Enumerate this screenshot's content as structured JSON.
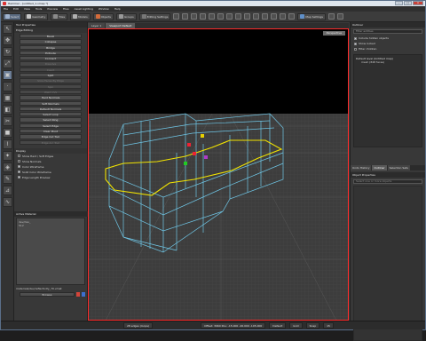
{
  "window": {
    "title": "Hammer - [untitled_1.vmap *]"
  },
  "menu": [
    "File",
    "Edit",
    "View",
    "Tools",
    "Preview",
    "Files",
    "Asset Lighting",
    "Window",
    "Help"
  ],
  "toolbar": {
    "groups": [
      "Select",
      "Geometry",
      "Tiles",
      "Models",
      "Objects",
      "Groups",
      "Editing Settings"
    ],
    "map_settings_label": "Map Settings",
    "right_tabs": [
      "Main",
      "Blend",
      "Mesh"
    ]
  },
  "viewport_tabs": [
    "Layer 1",
    "Viewport Default"
  ],
  "left_panel": {
    "title": "Tool Properties",
    "section": "Edge Editing",
    "buttons": [
      {
        "label": "Bevel",
        "enabled": true
      },
      {
        "label": "Collapse",
        "enabled": true
      },
      {
        "label": "Bridge",
        "enabled": true
      },
      {
        "label": "Extrude",
        "enabled": true
      },
      {
        "label": "Connect",
        "enabled": true
      },
      {
        "label": "Dissolve",
        "enabled": false
      },
      {
        "label": "Insert",
        "enabled": false
      },
      {
        "label": "Split",
        "enabled": true
      },
      {
        "label": "Slice Faces By Edge",
        "enabled": false
      },
      {
        "label": "Spin",
        "enabled": false
      },
      {
        "label": "Weld UVs",
        "enabled": false
      },
      {
        "label": "Hard Normals",
        "enabled": true
      },
      {
        "label": "Soft Normals",
        "enabled": true
      },
      {
        "label": "Default Normals",
        "enabled": true
      },
      {
        "label": "Select Loop",
        "enabled": true
      },
      {
        "label": "Select Ring",
        "enabled": true
      },
      {
        "label": "Select Edge",
        "enabled": true
      },
      {
        "label": "Clear Pivot",
        "enabled": true
      },
      {
        "label": "Edge Cut Tool",
        "enabled": true
      },
      {
        "label": "Edge Arc Tool",
        "enabled": false
      }
    ],
    "display_title": "Display",
    "checkboxes": [
      {
        "label": "Show Hard / Soft Edges",
        "on": false
      },
      {
        "label": "Show Normals",
        "on": false
      },
      {
        "label": "Color Wireframe",
        "on": true
      },
      {
        "label": "Solid Color Wireframe",
        "on": true
      },
      {
        "label": "Edge Length Preview",
        "on": true
      }
    ],
    "material_title": "Active Material",
    "material_info": [
      "dev/dev_",
      "512"
    ],
    "material_name": "materials/dev/reflectivity_70.vmat",
    "browse_label": "Browse"
  },
  "viewport": {
    "view_label": "Perspective"
  },
  "right_panel": {
    "title": "Outliner",
    "filter_label": "Filter entities",
    "options": [
      {
        "label": "Include hidden objects",
        "on": true
      },
      {
        "label": "Show locked",
        "on": true
      },
      {
        "label": "Filter children",
        "on": false
      }
    ],
    "tree_root": "Default level (Untitled map)",
    "tree_child": "mesh (848 faces)",
    "bottom_tabs": [
      "Undo History",
      "Outliner",
      "Selection Sets"
    ],
    "props_title": "Object Properties",
    "props_placeholder": "Select one or more objects"
  },
  "status": {
    "fps": "28 edges (loops)",
    "coords": "Offset: 3960  Pos: -15.000  -26.000  -105.000",
    "right": [
      "Default",
      "Grid",
      "Snap",
      "Angle: 15",
      "4",
      "Grid: 4",
      "Grid: 16",
      "Angle",
      "15"
    ]
  }
}
